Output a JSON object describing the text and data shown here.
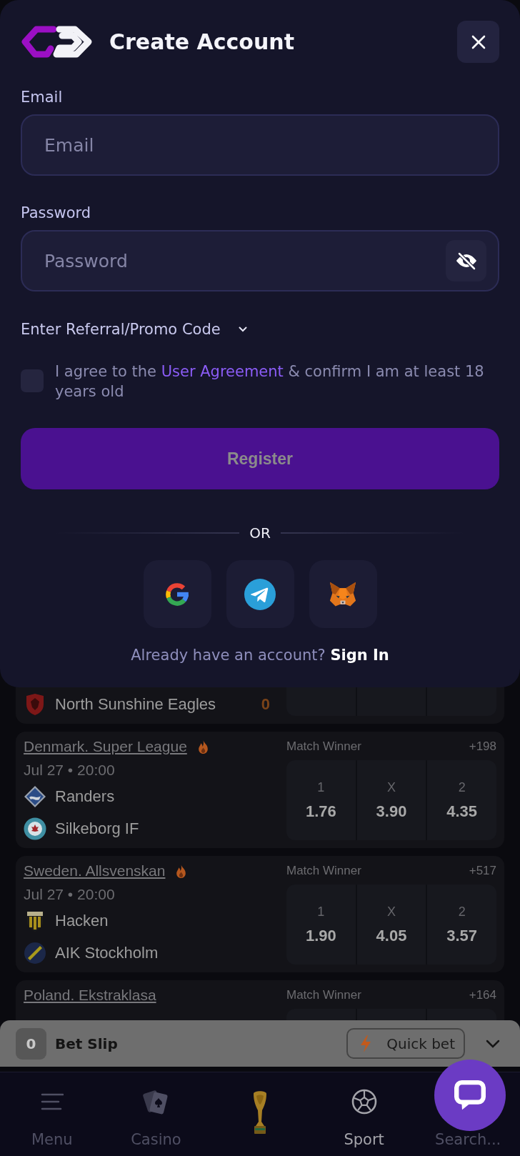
{
  "modal": {
    "title": "Create Account",
    "fields": [
      {
        "label": "Email",
        "placeholder": "Email",
        "kind": "email"
      },
      {
        "label": "Password",
        "placeholder": "Password",
        "kind": "password",
        "revealed": false
      }
    ],
    "promo": {
      "label": "Enter Referral/Promo Code",
      "expanded": false
    },
    "agreement": {
      "checked": false,
      "before": "I agree to the",
      "link": "User Agreement",
      "after": "& confirm I am at least 18 years old"
    },
    "register": {
      "label": "Register",
      "disabled": true
    },
    "separator": "OR",
    "social": [
      {
        "kind": "google"
      },
      {
        "kind": "telegram"
      },
      {
        "kind": "metamask"
      }
    ],
    "signin": {
      "prompt": "Already have an account?",
      "link": "Sign In"
    }
  },
  "matches": [
    {
      "kind": "cut_top",
      "teams": [
        {
          "name": "North Sunshine Eagles",
          "kind": "shield",
          "score": "0"
        }
      ]
    },
    {
      "kind": "full",
      "league": "Denmark. Super League",
      "hot": true,
      "time": "Jul 27 • 20:00",
      "market": "Match Winner",
      "more": "+198",
      "teams": [
        {
          "name": "Randers",
          "kind": "diamond"
        },
        {
          "name": "Silkeborg IF",
          "kind": "roundel"
        }
      ],
      "odds": [
        {
          "label": "1",
          "value": "1.76"
        },
        {
          "label": "X",
          "value": "3.90"
        },
        {
          "label": "2",
          "value": "4.35"
        }
      ]
    },
    {
      "kind": "full",
      "league": "Sweden. Allsvenskan",
      "hot": true,
      "time": "Jul 27 • 20:00",
      "market": "Match Winner",
      "more": "+517",
      "teams": [
        {
          "name": "Hacken",
          "kind": "striped"
        },
        {
          "name": "AIK Stockholm",
          "kind": "band"
        }
      ],
      "odds": [
        {
          "label": "1",
          "value": "1.90"
        },
        {
          "label": "X",
          "value": "4.05"
        },
        {
          "label": "2",
          "value": "3.57"
        }
      ]
    },
    {
      "kind": "cut_bottom",
      "league": "Poland. Ekstraklasa",
      "hot": false,
      "market": "Match Winner",
      "more": "+164"
    }
  ],
  "bet_slip": {
    "count": "0",
    "title": "Bet Slip",
    "quick_bet": "Quick bet",
    "expanded": false
  },
  "nav": [
    {
      "kind": "menu",
      "label": "Menu",
      "selected": false
    },
    {
      "kind": "casino",
      "label": "Casino",
      "selected": false
    },
    {
      "kind": "trophy",
      "selected": false
    },
    {
      "kind": "sport",
      "label": "Sport",
      "selected": true
    },
    {
      "kind": "search",
      "label": "Search...",
      "selected": false
    }
  ]
}
